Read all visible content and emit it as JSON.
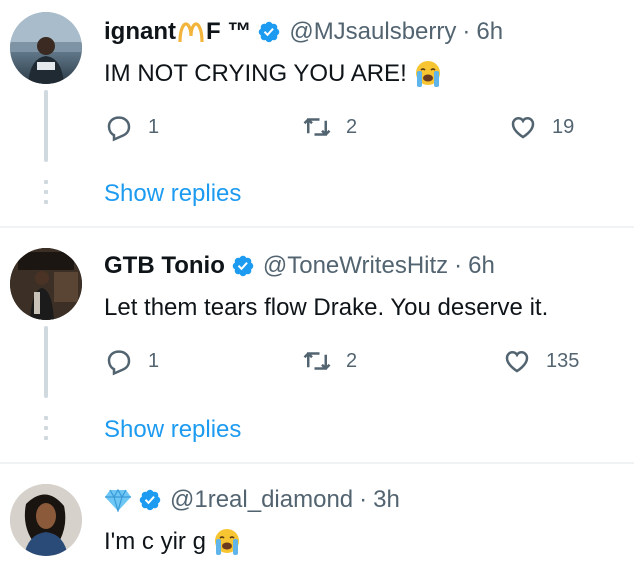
{
  "tweets": [
    {
      "display_name": "ignant",
      "name_suffix": "F ™",
      "handle": "@MJsaulsberry",
      "separator": "·",
      "time": "6h",
      "text": "IM NOT CRYING YOU ARE!",
      "replies": "1",
      "retweets": "2",
      "likes": "19",
      "show_replies": "Show replies"
    },
    {
      "display_name": "GTB Tonio",
      "handle": "@ToneWritesHitz",
      "separator": "·",
      "time": "6h",
      "text": "Let them tears flow Drake. You deserve it.",
      "replies": "1",
      "retweets": "2",
      "likes": "135",
      "show_replies": "Show replies"
    },
    {
      "display_name": "",
      "handle": "@1real_diamond",
      "separator": "·",
      "time": "3h",
      "text": "I'm c yir g"
    }
  ],
  "colors": {
    "verified": "#1d9bf0",
    "link": "#1d9bf0",
    "muted": "#536471",
    "diamond": "#6ec6f5",
    "emoji_yellow": "#f7c531"
  },
  "icons": [
    "verified-badge-icon",
    "reply-icon",
    "retweet-icon",
    "like-icon",
    "loudly-crying-face-icon",
    "diamond-icon",
    "mcdonalds-arches-icon"
  ]
}
